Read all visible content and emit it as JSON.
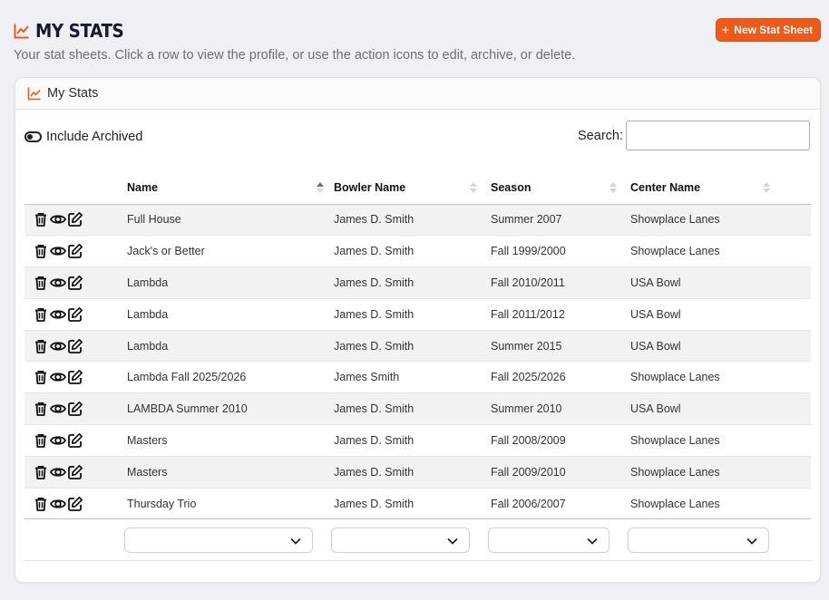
{
  "page": {
    "title": "MY STATS",
    "subtitle": "Your stat sheets. Click a row to view the profile, or use the action icons to edit, archive, or delete.",
    "new_button_label": "New Stat Sheet",
    "accent_color": "#ee5a1a"
  },
  "card": {
    "title": "My Stats",
    "include_archived_label": "Include Archived",
    "search_label": "Search:",
    "search_value": ""
  },
  "table": {
    "columns": [
      "Name",
      "Bowler Name",
      "Season",
      "Center Name"
    ],
    "rows": [
      {
        "name": "Full House",
        "bowler": "James D. Smith",
        "season": "Summer 2007",
        "center": "Showplace Lanes"
      },
      {
        "name": "Jack's or Better",
        "bowler": "James D. Smith",
        "season": "Fall 1999/2000",
        "center": "Showplace Lanes"
      },
      {
        "name": "Lambda",
        "bowler": "James D. Smith",
        "season": "Fall 2010/2011",
        "center": "USA Bowl"
      },
      {
        "name": "Lambda",
        "bowler": "James D. Smith",
        "season": "Fall 2011/2012",
        "center": "USA Bowl"
      },
      {
        "name": "Lambda",
        "bowler": "James D. Smith",
        "season": "Summer 2015",
        "center": "USA Bowl"
      },
      {
        "name": "Lambda Fall 2025/2026",
        "bowler": "James Smith",
        "season": "Fall 2025/2026",
        "center": "Showplace Lanes"
      },
      {
        "name": "LAMBDA Summer 2010",
        "bowler": "James D. Smith",
        "season": "Summer 2010",
        "center": "USA Bowl"
      },
      {
        "name": "Masters",
        "bowler": "James D. Smith",
        "season": "Fall 2008/2009",
        "center": "Showplace Lanes"
      },
      {
        "name": "Masters",
        "bowler": "James D. Smith",
        "season": "Fall 2009/2010",
        "center": "Showplace Lanes"
      },
      {
        "name": "Thursday Trio",
        "bowler": "James D. Smith",
        "season": "Fall 2006/2007",
        "center": "Showplace Lanes"
      }
    ],
    "row_actions": [
      "trash-icon",
      "eye-icon",
      "edit-icon"
    ],
    "sorted_column": "Name",
    "sort_direction": "ascending"
  }
}
